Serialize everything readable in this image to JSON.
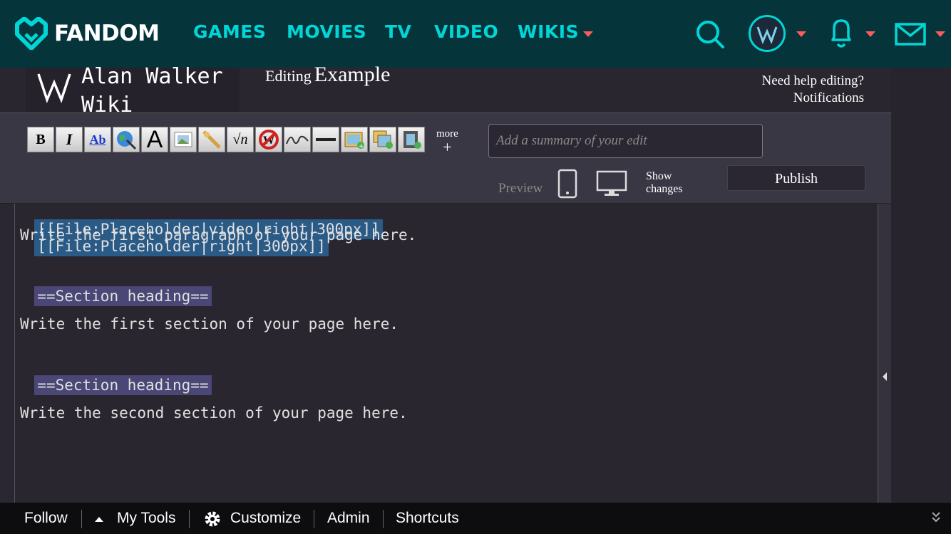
{
  "topnav": {
    "brand": "FANDOM",
    "items": [
      "GAMES",
      "MOVIES",
      "TV",
      "VIDEO",
      "WIKIS"
    ]
  },
  "wiki": {
    "name_line1": "Alan Walker",
    "name_line2": "Wiki",
    "editing_label": "Editing",
    "page_title": "Example",
    "help_link": "Need help editing?",
    "notifications_link": "Notifications"
  },
  "toolbar": {
    "buttons": [
      "bold",
      "italic",
      "internal-link",
      "external-link",
      "heading",
      "embedded-file",
      "media-link",
      "math",
      "ignore-formatting",
      "signature",
      "horizontal-line",
      "add-photo",
      "add-gallery",
      "add-video"
    ],
    "more_label": "more",
    "more_plus": "+",
    "summary_placeholder": "Add a summary of your edit",
    "preview_label": "Preview",
    "show_changes_line1": "Show",
    "show_changes_line2": "changes",
    "publish_label": "Publish"
  },
  "editor": {
    "file1": "[[File:Placeholder|video|right|300px]]",
    "file2": "[[File:Placeholder|right|300px]]",
    "para1": "Write the first paragraph of your page here.",
    "heading1": "==Section heading==",
    "sec1": "Write the first section of your page here.",
    "heading2": "==Section heading==",
    "sec2": "Write the second section of your page here."
  },
  "bottombar": {
    "follow": "Follow",
    "mytools": "My Tools",
    "customize": "Customize",
    "admin": "Admin",
    "shortcuts": "Shortcuts"
  },
  "colors": {
    "topbar": "#06343b",
    "accent": "#00d6d6",
    "caret": "#fa5c5c",
    "file_highlight": "#2a5a86",
    "section_highlight": "#4a4675"
  }
}
